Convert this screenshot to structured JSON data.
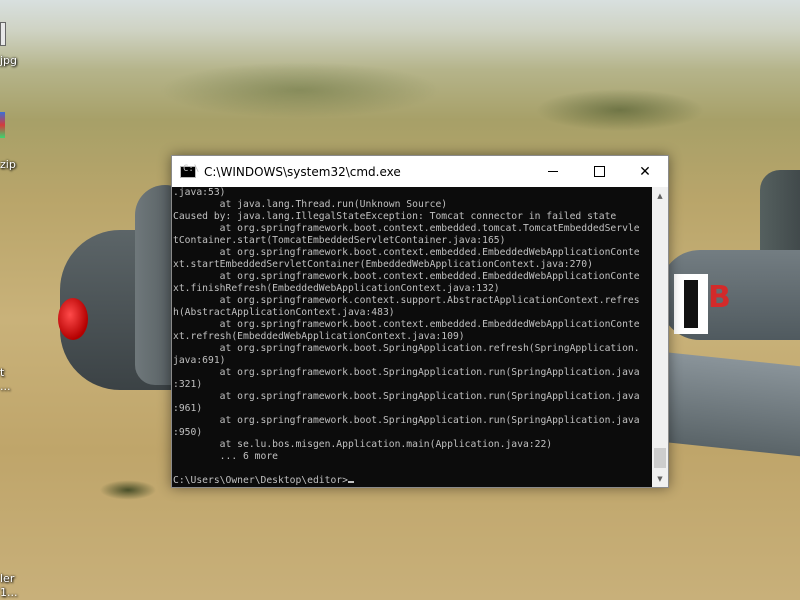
{
  "desktop": {
    "icons": [
      {
        "label": "jpg"
      },
      {
        "label": "zip"
      },
      {
        "label": "t"
      },
      {
        "label": "..."
      },
      {
        "label": "ler"
      },
      {
        "label": "1..."
      }
    ],
    "plane_marking": "B"
  },
  "window": {
    "title": "C:\\WINDOWS\\system32\\cmd.exe",
    "icon_text": "C:\\",
    "buttons": {
      "minimize": "minimize",
      "maximize": "maximize",
      "close": "✕"
    }
  },
  "console": {
    "lines": [
      ".java:53)",
      "        at java.lang.Thread.run(Unknown Source)",
      "Caused by: java.lang.IllegalStateException: Tomcat connector in failed state",
      "        at org.springframework.boot.context.embedded.tomcat.TomcatEmbeddedServle",
      "tContainer.start(TomcatEmbeddedServletContainer.java:165)",
      "        at org.springframework.boot.context.embedded.EmbeddedWebApplicationConte",
      "xt.startEmbeddedServletContainer(EmbeddedWebApplicationContext.java:270)",
      "        at org.springframework.boot.context.embedded.EmbeddedWebApplicationConte",
      "xt.finishRefresh(EmbeddedWebApplicationContext.java:132)",
      "        at org.springframework.context.support.AbstractApplicationContext.refres",
      "h(AbstractApplicationContext.java:483)",
      "        at org.springframework.boot.context.embedded.EmbeddedWebApplicationConte",
      "xt.refresh(EmbeddedWebApplicationContext.java:109)",
      "        at org.springframework.boot.SpringApplication.refresh(SpringApplication.",
      "java:691)",
      "        at org.springframework.boot.SpringApplication.run(SpringApplication.java",
      ":321)",
      "        at org.springframework.boot.SpringApplication.run(SpringApplication.java",
      ":961)",
      "        at org.springframework.boot.SpringApplication.run(SpringApplication.java",
      ":950)",
      "        at se.lu.bos.misgen.Application.main(Application.java:22)",
      "        ... 6 more",
      "",
      "C:\\Users\\Owner\\Desktop\\editor>"
    ],
    "cursor": "_"
  },
  "colors": {
    "console_bg": "#0c0c0c",
    "console_fg": "#c0c0c0",
    "titlebar_bg": "#ffffff"
  }
}
